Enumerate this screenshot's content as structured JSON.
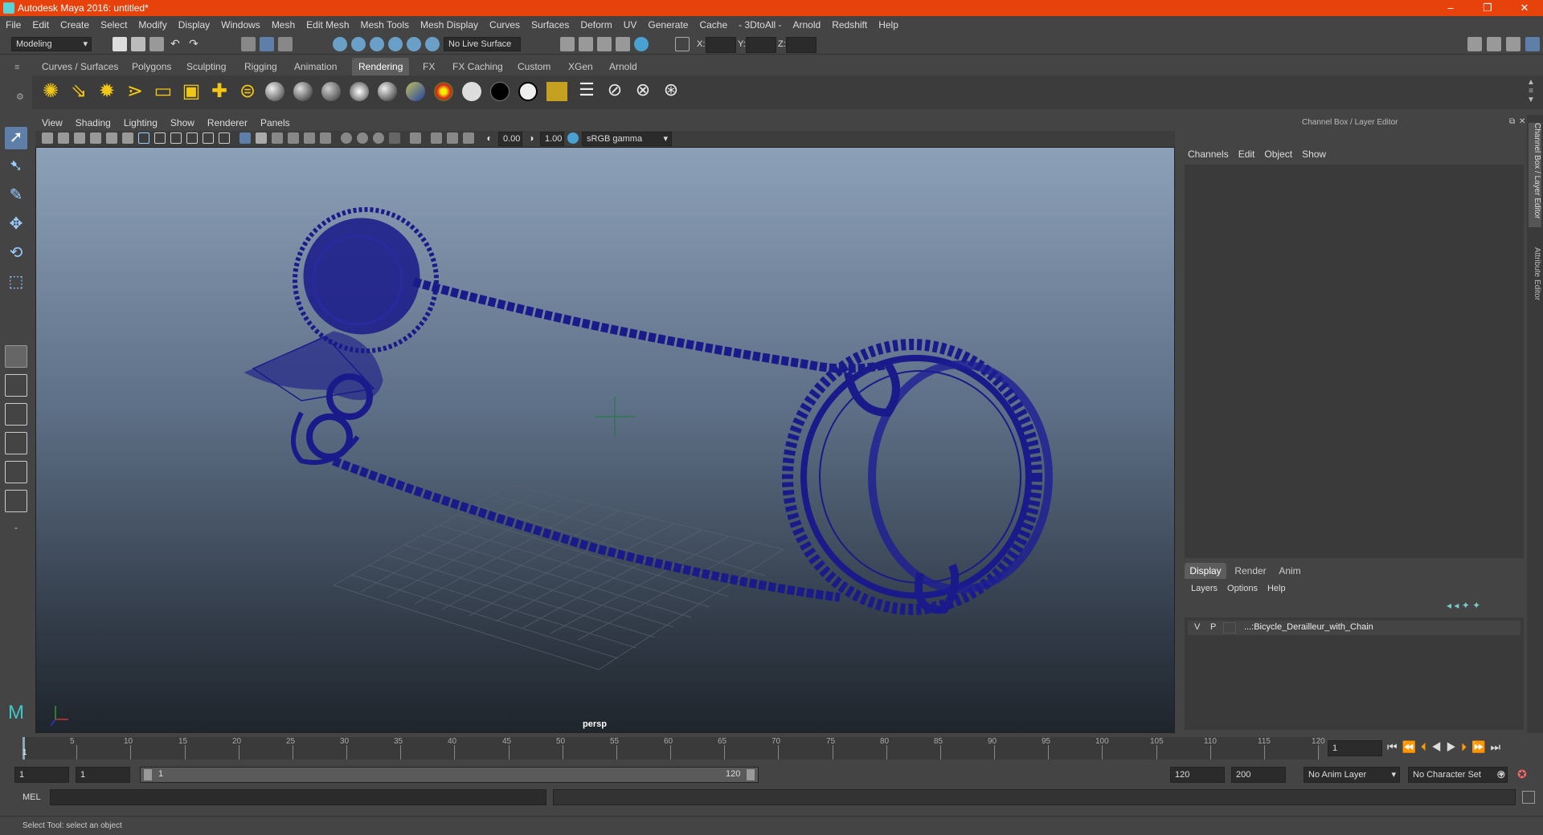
{
  "window": {
    "title": "Autodesk Maya 2016: untitled*"
  },
  "menu": [
    "File",
    "Edit",
    "Create",
    "Select",
    "Modify",
    "Display",
    "Windows",
    "Mesh",
    "Edit Mesh",
    "Mesh Tools",
    "Mesh Display",
    "Curves",
    "Surfaces",
    "Deform",
    "UV",
    "Generate",
    "Cache",
    "- 3DtoAll -",
    "Arnold",
    "Redshift",
    "Help"
  ],
  "status": {
    "mode": "Modeling",
    "live_surface": "No Live Surface",
    "x_label": "X:",
    "y_label": "Y:",
    "z_label": "Z:"
  },
  "shelf_tabs": [
    "Curves / Surfaces",
    "Polygons",
    "Sculpting",
    "Rigging",
    "Animation",
    "Rendering",
    "FX",
    "FX Caching",
    "Custom",
    "XGen",
    "Arnold"
  ],
  "active_shelf_tab": "Rendering",
  "viewport": {
    "menu": [
      "View",
      "Shading",
      "Lighting",
      "Show",
      "Renderer",
      "Panels"
    ],
    "exposure": "0.00",
    "gamma": "1.00",
    "color_space": "sRGB gamma",
    "camera_label": "persp",
    "wire_color": "#1a1a8a"
  },
  "channel_box": {
    "title": "Channel Box / Layer Editor",
    "menu": [
      "Channels",
      "Edit",
      "Object",
      "Show"
    ],
    "side_tabs": [
      "Channel Box / Layer Editor",
      "Attribute Editor"
    ]
  },
  "layer_editor": {
    "tabs": [
      "Display",
      "Render",
      "Anim"
    ],
    "active_tab": "Display",
    "menu": [
      "Layers",
      "Options",
      "Help"
    ],
    "layers": [
      {
        "v": "V",
        "p": "P",
        "name": "...:Bicycle_Derailleur_with_Chain"
      }
    ]
  },
  "timeline": {
    "ticks": [
      "5",
      "10",
      "15",
      "20",
      "25",
      "30",
      "35",
      "40",
      "45",
      "50",
      "55",
      "60",
      "65",
      "70",
      "75",
      "80",
      "85",
      "90",
      "95",
      "100",
      "105",
      "110",
      "115",
      "120"
    ],
    "start_label": "1",
    "current_frame": "1"
  },
  "range": {
    "start": "1",
    "playback_start": "1",
    "slider_start": "1",
    "slider_end": "120",
    "playback_end": "120",
    "end": "200",
    "anim_layer": "No Anim Layer",
    "character_set": "No Character Set"
  },
  "command": {
    "label": "MEL"
  },
  "help_line": "Select Tool: select an object",
  "colors": {
    "title_bar": "#e8420c",
    "active_tab": "#5d5d5d",
    "panel": "#444444",
    "wireframe": "#1a1a8a"
  }
}
